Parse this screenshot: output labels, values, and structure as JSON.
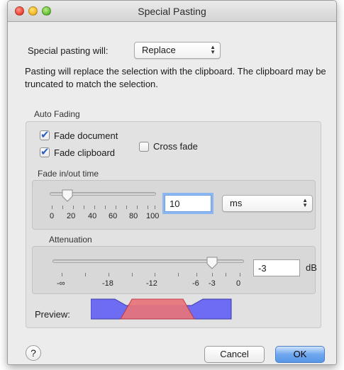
{
  "window": {
    "title": "Special Pasting"
  },
  "paste": {
    "label": "Special pasting will:",
    "mode": "Replace",
    "description": "Pasting will replace the selection with the clipboard. The clipboard may be truncated to match the selection."
  },
  "auto_fading": {
    "label": "Auto Fading",
    "fade_document": {
      "label": "Fade document",
      "checked": true
    },
    "fade_clipboard": {
      "label": "Fade clipboard",
      "checked": true
    },
    "cross_fade": {
      "label": "Cross fade",
      "checked": false
    },
    "fade_time": {
      "label": "Fade in/out time",
      "value": "10",
      "unit": "ms",
      "slider_ticks": [
        "0",
        "20",
        "40",
        "60",
        "80",
        "100"
      ]
    },
    "attenuation": {
      "label": "Attenuation",
      "value": "-3",
      "unit": "dB",
      "slider_ticks": [
        "-∞",
        "-18",
        "-12",
        "-6",
        "-3",
        "0"
      ]
    },
    "preview_label": "Preview:"
  },
  "buttons": {
    "help": "?",
    "cancel": "Cancel",
    "ok": "OK"
  },
  "colors": {
    "preview_fill": "#6d6cf2",
    "preview_overlay": "#e8747a",
    "accent": "#3b82f0"
  }
}
